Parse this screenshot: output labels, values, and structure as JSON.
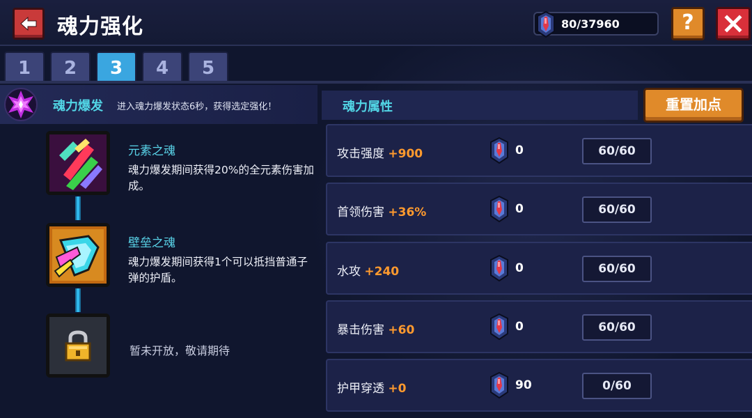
{
  "header": {
    "title": "魂力强化",
    "currency_value": "80/37960",
    "help_label": "?"
  },
  "tabs": [
    {
      "label": "1",
      "active": false
    },
    {
      "label": "2",
      "active": false
    },
    {
      "label": "3",
      "active": true
    },
    {
      "label": "4",
      "active": false
    },
    {
      "label": "5",
      "active": false
    }
  ],
  "burst": {
    "title": "魂力爆发",
    "description": "进入魂力爆发状态6秒，获得选定强化！",
    "icon": "soul-burst-icon"
  },
  "souls": [
    {
      "name": "元素之魂",
      "description": "魂力爆发期间获得20%的全元素伤害加成。",
      "icon": "element-crystals-icon"
    },
    {
      "name": "壁垒之魂",
      "description": "魂力爆发期间获得1个可以抵挡普通子弹的护盾。",
      "icon": "shield-icon"
    },
    {
      "locked_text": "暂未开放，敬请期待",
      "icon": "lock-icon"
    }
  ],
  "attributes": {
    "title": "魂力属性",
    "reset_label": "重置加点",
    "rows": [
      {
        "name": "攻击强度",
        "bonus": "+900",
        "cost": "0",
        "level": "60/60"
      },
      {
        "name": "首领伤害",
        "bonus": "+36%",
        "cost": "0",
        "level": "60/60"
      },
      {
        "name": "水攻",
        "bonus": "+240",
        "cost": "0",
        "level": "60/60"
      },
      {
        "name": "暴击伤害",
        "bonus": "+60",
        "cost": "0",
        "level": "60/60"
      },
      {
        "name": "护甲穿透",
        "bonus": "+0",
        "cost": "90",
        "level": "0/60"
      }
    ]
  },
  "colors": {
    "accent_cyan": "#52d6e6",
    "bonus_orange": "#ff9a2e",
    "tab_active": "#3aa6e0",
    "button_orange": "#e08a2a",
    "close_red": "#d9303a"
  }
}
